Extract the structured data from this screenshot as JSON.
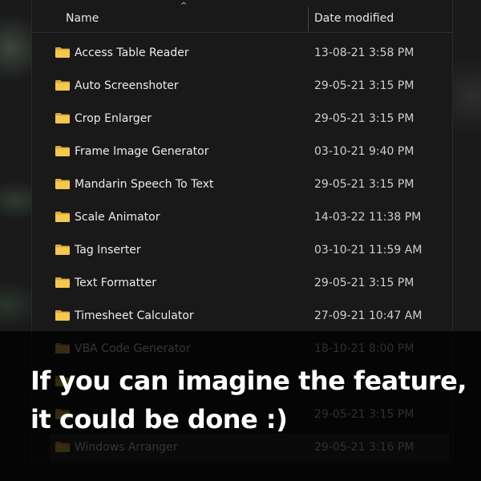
{
  "explorer": {
    "sort_indicator": "^",
    "columns": {
      "name": "Name",
      "date_modified": "Date modified"
    },
    "items": [
      {
        "name": "Access Table Reader",
        "date": "13-08-21 3:58 PM"
      },
      {
        "name": "Auto Screenshoter",
        "date": "29-05-21 3:15 PM"
      },
      {
        "name": "Crop Enlarger",
        "date": "29-05-21 3:15 PM"
      },
      {
        "name": "Frame Image Generator",
        "date": "03-10-21 9:40 PM"
      },
      {
        "name": "Mandarin Speech To Text",
        "date": "29-05-21 3:15 PM"
      },
      {
        "name": "Scale Animator",
        "date": "14-03-22 11:38 PM"
      },
      {
        "name": "Tag Inserter",
        "date": "03-10-21 11:59 AM"
      },
      {
        "name": "Text Formatter",
        "date": "29-05-21 3:15 PM"
      },
      {
        "name": "Timesheet Calculator",
        "date": "27-09-21 10:47 AM"
      },
      {
        "name": "VBA Code Generator",
        "date": "18-10-21 8:00 PM"
      },
      {
        "name": "",
        "date": ""
      },
      {
        "name": "",
        "date": "29-05-21 3:15 PM"
      },
      {
        "name": "Windows Arranger",
        "date": "29-05-21 3:16 PM",
        "selected": true
      }
    ],
    "folder_icon": "folder-icon",
    "folder_color": "#f4c74e"
  },
  "caption": {
    "line1": "If you can imagine the feature,",
    "line2": "it could be done :)"
  }
}
